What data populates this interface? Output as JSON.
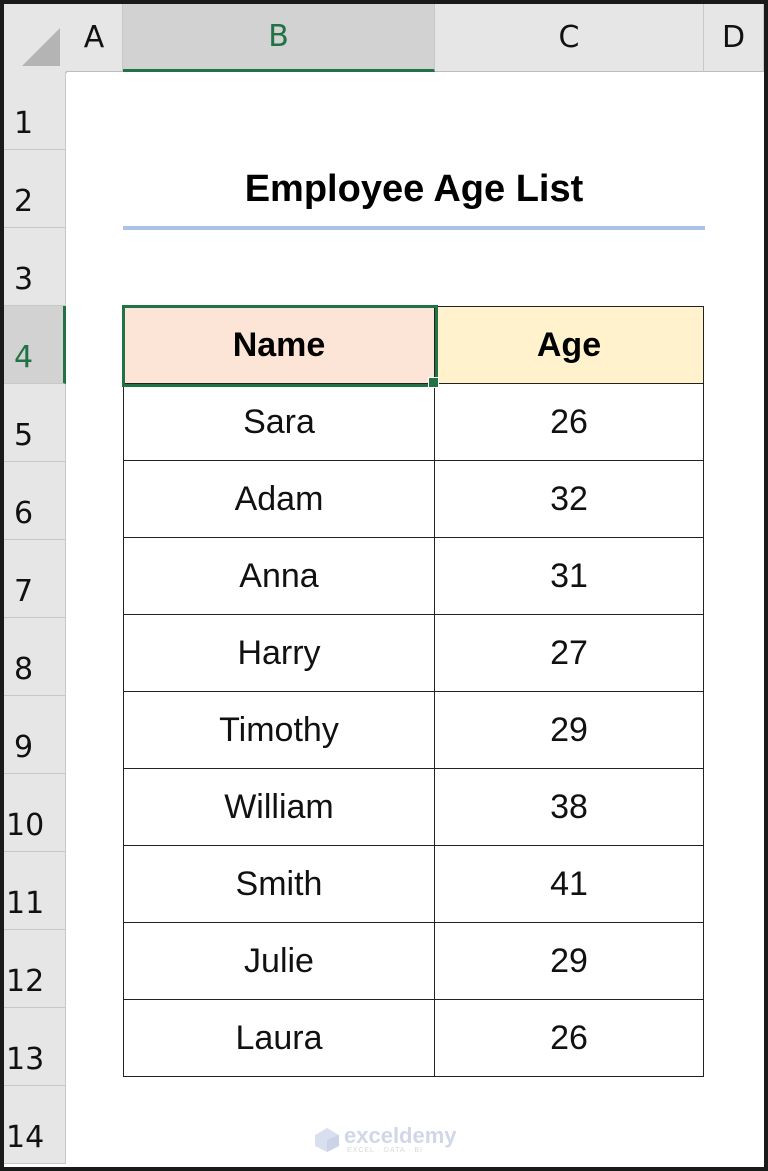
{
  "columns": [
    "A",
    "B",
    "C",
    "D"
  ],
  "selected_column": "B",
  "rows": [
    "1",
    "2",
    "3",
    "4",
    "5",
    "6",
    "7",
    "8",
    "9",
    "10",
    "11",
    "12",
    "13",
    "14"
  ],
  "selected_row": "4",
  "title": "Employee Age List",
  "table": {
    "headers": {
      "name": "Name",
      "age": "Age"
    },
    "rows": [
      {
        "name": "Sara",
        "age": "26"
      },
      {
        "name": "Adam",
        "age": "32"
      },
      {
        "name": "Anna",
        "age": "31"
      },
      {
        "name": "Harry",
        "age": "27"
      },
      {
        "name": "Timothy",
        "age": "29"
      },
      {
        "name": "William",
        "age": "38"
      },
      {
        "name": "Smith",
        "age": "41"
      },
      {
        "name": "Julie",
        "age": "29"
      },
      {
        "name": "Laura",
        "age": "26"
      }
    ]
  },
  "watermark": {
    "brand": "exceldemy",
    "tagline": "EXCEL · DATA · BI"
  },
  "colors": {
    "selection": "#217346",
    "name_header_fill": "#fce4d6",
    "age_header_fill": "#fff2cc",
    "title_underline": "#a9c4e8"
  }
}
